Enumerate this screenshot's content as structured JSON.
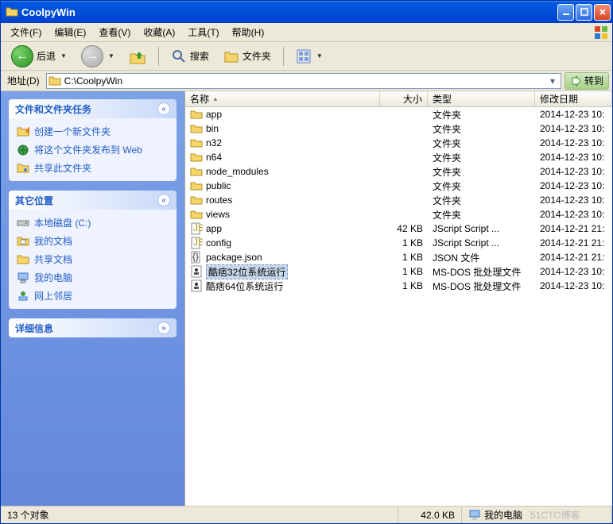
{
  "title": "CoolpyWin",
  "menus": [
    "文件(F)",
    "编辑(E)",
    "查看(V)",
    "收藏(A)",
    "工具(T)",
    "帮助(H)"
  ],
  "toolbar": {
    "back": "后退",
    "search": "搜索",
    "folders": "文件夹"
  },
  "address": {
    "label": "地址(D)",
    "path": "C:\\CoolpyWin",
    "go": "转到"
  },
  "panels": {
    "tasks": {
      "title": "文件和文件夹任务",
      "links": [
        "创建一个新文件夹",
        "将这个文件夹发布到 Web",
        "共享此文件夹"
      ]
    },
    "other": {
      "title": "其它位置",
      "links": [
        "本地磁盘 (C:)",
        "我的文档",
        "共享文档",
        "我的电脑",
        "网上邻居"
      ]
    },
    "details": {
      "title": "详细信息"
    }
  },
  "columns": {
    "name": "名称",
    "size": "大小",
    "type": "类型",
    "date": "修改日期"
  },
  "files": [
    {
      "icon": "folder",
      "name": "app",
      "size": "",
      "type": "文件夹",
      "date": "2014-12-23 10:"
    },
    {
      "icon": "folder",
      "name": "bin",
      "size": "",
      "type": "文件夹",
      "date": "2014-12-23 10:"
    },
    {
      "icon": "folder",
      "name": "n32",
      "size": "",
      "type": "文件夹",
      "date": "2014-12-23 10:"
    },
    {
      "icon": "folder",
      "name": "n64",
      "size": "",
      "type": "文件夹",
      "date": "2014-12-23 10:"
    },
    {
      "icon": "folder",
      "name": "node_modules",
      "size": "",
      "type": "文件夹",
      "date": "2014-12-23 10:"
    },
    {
      "icon": "folder",
      "name": "public",
      "size": "",
      "type": "文件夹",
      "date": "2014-12-23 10:"
    },
    {
      "icon": "folder",
      "name": "routes",
      "size": "",
      "type": "文件夹",
      "date": "2014-12-23 10:"
    },
    {
      "icon": "folder",
      "name": "views",
      "size": "",
      "type": "文件夹",
      "date": "2014-12-23 10:"
    },
    {
      "icon": "js",
      "name": "app",
      "size": "42 KB",
      "type": "JScript Script ...",
      "date": "2014-12-21 21:"
    },
    {
      "icon": "js",
      "name": "config",
      "size": "1 KB",
      "type": "JScript Script ...",
      "date": "2014-12-21 21:"
    },
    {
      "icon": "json",
      "name": "package.json",
      "size": "1 KB",
      "type": "JSON 文件",
      "date": "2014-12-21 21:"
    },
    {
      "icon": "bat",
      "name": "酷痞32位系统运行",
      "size": "1 KB",
      "type": "MS-DOS 批处理文件",
      "date": "2014-12-23 10:",
      "selected": true
    },
    {
      "icon": "bat",
      "name": "酷痞64位系统运行",
      "size": "1 KB",
      "type": "MS-DOS 批处理文件",
      "date": "2014-12-23 10:"
    }
  ],
  "status": {
    "count": "13 个对象",
    "size": "42.0 KB",
    "location": "我的电脑",
    "watermark": "51CTO博客"
  }
}
